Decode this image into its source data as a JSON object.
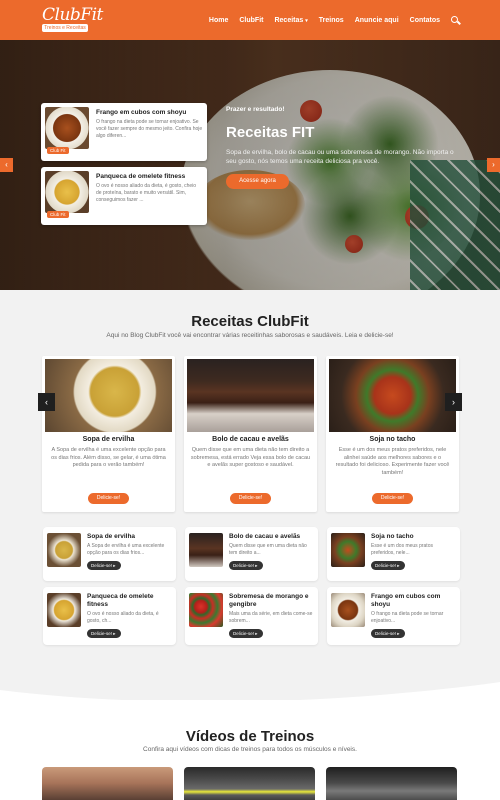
{
  "header": {
    "logo_text": "ClubFit",
    "logo_sub": "Treinos e Receitas",
    "nav": [
      {
        "label": "Home"
      },
      {
        "label": "ClubFit"
      },
      {
        "label": "Receitas",
        "has_caret": true
      },
      {
        "label": "Treinos"
      },
      {
        "label": "Anuncie aqui"
      },
      {
        "label": "Contatos"
      }
    ],
    "search_icon": "search-icon",
    "bg_color": "#ec6a2c"
  },
  "hero": {
    "cards": [
      {
        "title": "Frango em cubos com shoyu",
        "desc": "O frango na dieta pode se tornar enjoativo. Se você fazer sempre do mesmo jeito. Confira hoje algo diferen...",
        "badge": "Club Fit"
      },
      {
        "title": "Panqueca de omelete fitness",
        "desc": "O ovo é nosso aliado da dieta, é gosto, cheio de proteína, barato e muito versátil. Sim, conseguimos fazer ...",
        "badge": "Club Fit"
      }
    ],
    "tag": "Prazer e resultado!",
    "title": "Receitas FIT",
    "text": "Sopa de ervilha, bolo de cacau ou uma sobremesa de morango. Não importa o seu gosto, nós temos uma receita deliciosa pra você.",
    "button": "Acesse agora",
    "arrow_left": "‹",
    "arrow_right": "›"
  },
  "recipes": {
    "title": "Receitas ClubFit",
    "subtitle": "Aqui no Blog ClubFit você vai encontrar várias receitinhas saborosas e saudáveis. Leia e delicie-se!",
    "carousel": [
      {
        "title": "Sopa de ervilha",
        "desc": "A Sopa de ervilha é uma excelente opção para os dias frios. Além disso, se gelar, é uma ótima pedida para o verão também!",
        "button": "Delicie-se!"
      },
      {
        "title": "Bolo de cacau e avelãs",
        "desc": "Quem disse que em uma dieta não tem direito a sobremesa, está errado Veja essa bolo de cacau e avelãs super gostoso e saudável.",
        "button": "Delicie-se!"
      },
      {
        "title": "Soja no tacho",
        "desc": "Esse é um dos meus pratos preferidos, nele alinhei saúde aos melhores sabores e o resultado foi delicioso. Experimente fazer você também!",
        "button": "Delicie-se!"
      }
    ],
    "arrow_left": "‹",
    "arrow_right": "›",
    "mini": [
      {
        "title": "Sopa de ervilha",
        "desc": "A Sopa de ervilha é uma excelente opção para os dias frios...",
        "button": "Delicie-se! ▸"
      },
      {
        "title": "Bolo de cacau e avelãs",
        "desc": "Quem disse que em uma dieta não tem direito a...",
        "button": "Delicie-se! ▸"
      },
      {
        "title": "Soja no tacho",
        "desc": "Esse é um dos meus pratos preferidos, nele...",
        "button": "Delicie-se! ▸"
      },
      {
        "title": "Panqueca de omelete fitness",
        "desc": "O ovo é nosso aliado da dieta, é gosto, ch...",
        "button": "Delicie-se! ▸"
      },
      {
        "title": "Sobremesa de morango e gengibre",
        "desc": "Mais uma da série, em dieta come-se sobrem...",
        "button": "Delicie-se! ▸"
      },
      {
        "title": "Frango em cubos com shoyu",
        "desc": "O frango na dieta pode se tornar enjoativo...",
        "button": "Delicie-se! ▸"
      }
    ]
  },
  "videos": {
    "title": "Vídeos de Treinos",
    "subtitle": "Confira aqui vídeos com dicas de treinos para todos os músculos e níveis."
  }
}
